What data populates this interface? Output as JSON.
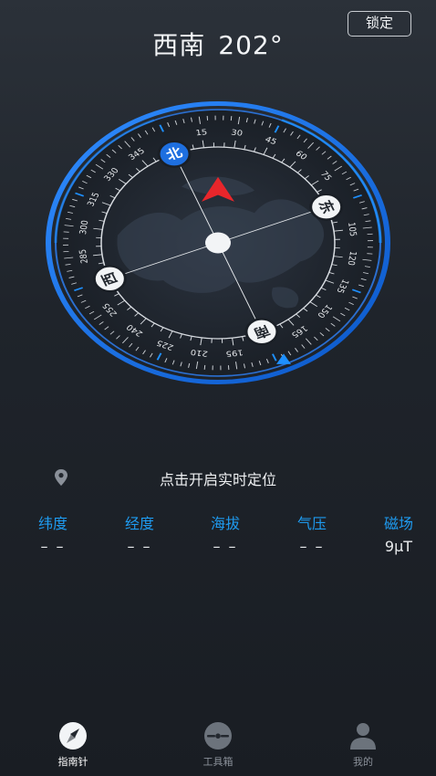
{
  "header": {
    "direction": "西南",
    "degrees": "202°",
    "lock_label": "锁定"
  },
  "compass": {
    "heading_deg": 202,
    "cardinals": {
      "north": "北",
      "south": "南",
      "east": "东",
      "west": "西"
    },
    "degree_labels": [
      "15",
      "30",
      "45",
      "60",
      "75",
      "105",
      "120",
      "135",
      "150",
      "165",
      "195",
      "210",
      "225",
      "240",
      "255",
      "285",
      "300",
      "315",
      "330",
      "345"
    ],
    "accent_color": "#1e90ff",
    "pointer_color": "#e8262b"
  },
  "location": {
    "prompt": "点击开启实时定位"
  },
  "stats": [
    {
      "label": "纬度",
      "value": "– –"
    },
    {
      "label": "经度",
      "value": "– –"
    },
    {
      "label": "海拔",
      "value": "– –"
    },
    {
      "label": "气压",
      "value": "– –"
    },
    {
      "label": "磁场",
      "value": "9µT"
    }
  ],
  "tabs": [
    {
      "label": "指南针",
      "icon": "compass-icon",
      "active": true
    },
    {
      "label": "工具箱",
      "icon": "toolbox-icon",
      "active": false
    },
    {
      "label": "我的",
      "icon": "person-icon",
      "active": false
    }
  ],
  "colors": {
    "accent": "#1e9bf0",
    "background": "#23282f"
  }
}
